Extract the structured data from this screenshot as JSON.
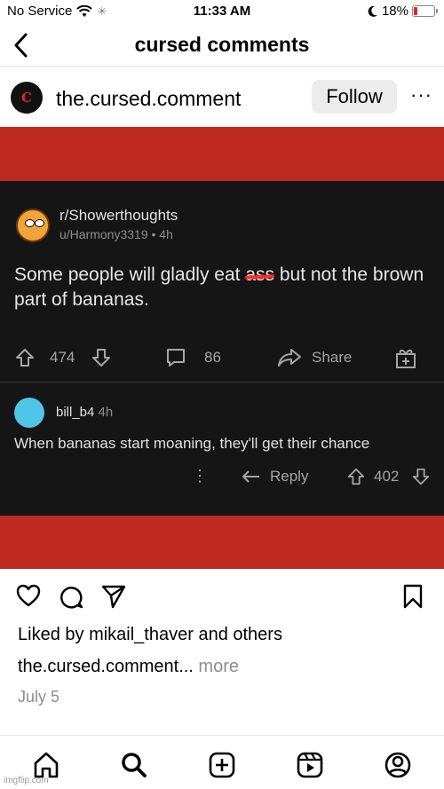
{
  "status_bar": {
    "carrier": "No Service",
    "time": "11:33 AM",
    "battery": "18%",
    "battery_level": 0.18
  },
  "nav": {
    "title": "cursed comments"
  },
  "post": {
    "avatar_text": "C",
    "username": "the.cursed.comment",
    "follow_label": "Follow",
    "media": {
      "subreddit": "r/Showerthoughts",
      "author_line": "u/Harmony3319 • 4h",
      "text_before": "Some people will gladly eat ",
      "text_struck": "ass",
      "text_after": " but not the brown part of bananas.",
      "upvotes": "474",
      "comments": "86",
      "share_label": "Share",
      "comment": {
        "user": "bill_b4",
        "time": "4h",
        "text": "When bananas start moaning, they'll get their chance",
        "reply_label": "Reply",
        "votes": "402"
      }
    },
    "liked_prefix": "Liked by ",
    "liked_user": "mikail_thaver",
    "liked_mid": " and ",
    "liked_others": "others",
    "caption_user": "the.cursed.comment",
    "caption_rest": "...",
    "caption_more": " more",
    "date": "July 5"
  },
  "watermark": "imgflip.com",
  "colors": {
    "red_band": "#be2a1f",
    "dark_bg": "#151515",
    "accent_red": "#e2251b"
  }
}
